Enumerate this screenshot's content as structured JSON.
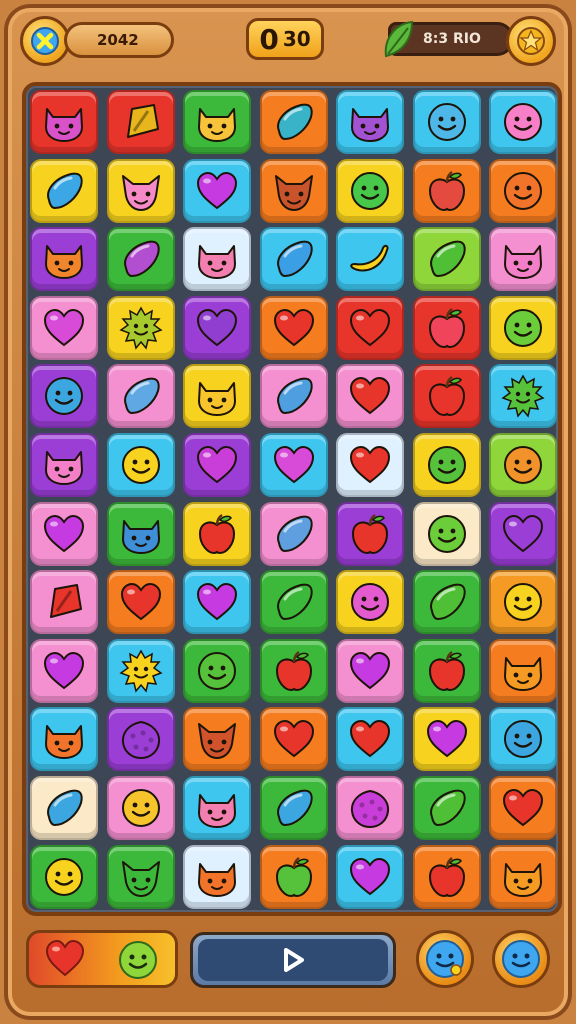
{
  "header": {
    "close_icon": "close-x-icon",
    "level_text": "2042",
    "score_big": "0",
    "score_small": "30",
    "energy_text": "8:3 RIO",
    "leaf_icon": "leaf-icon",
    "coin_icon": "star-coin-icon"
  },
  "colors": {
    "red": "#e8352b",
    "orange": "#f57c1f",
    "green": "#3cb93a",
    "lime": "#8fd63a",
    "yellow": "#f7d21e",
    "cyan": "#3ec6ef",
    "pink": "#f48fd0",
    "purple": "#9b3ed6",
    "magenta": "#d84bd8",
    "pale": "#dff0ff",
    "cream": "#fbe9c8",
    "orange2": "#f59b23"
  },
  "board": {
    "rows": [
      [
        [
          "red",
          "cat-face",
          "#d952c9"
        ],
        [
          "red",
          "candy",
          "#e8b61c"
        ],
        [
          "green",
          "cat-face",
          "#f6c33b"
        ],
        [
          "orange",
          "drop",
          "#39b3c7"
        ],
        [
          "cyan",
          "cat-face",
          "#a352d3"
        ],
        [
          "cyan",
          "smiley",
          "#4fb6e8"
        ],
        [
          "cyan",
          "smiley",
          "#f77fc8"
        ]
      ],
      [
        [
          "yellow",
          "drop",
          "#3ba7e4"
        ],
        [
          "yellow",
          "fox",
          "#f68ac6"
        ],
        [
          "cyan",
          "heart",
          "#c63ae1"
        ],
        [
          "orange",
          "fox",
          "#c9532b"
        ],
        [
          "yellow",
          "smiley",
          "#47c84a"
        ],
        [
          "orange",
          "apple",
          "#e44a3d"
        ],
        [
          "orange",
          "smiley",
          "#f2742a"
        ]
      ],
      [
        [
          "purple",
          "cat-face",
          "#f1852c"
        ],
        [
          "green",
          "drop",
          "#b24fd0"
        ],
        [
          "pale",
          "cat-face",
          "#f27fb0"
        ],
        [
          "cyan",
          "drop",
          "#3a9fe4"
        ],
        [
          "cyan",
          "banana",
          "#f7d21e"
        ],
        [
          "lime",
          "drop",
          "#4fbf35"
        ],
        [
          "pink",
          "cat-face",
          "#f27fc8"
        ]
      ],
      [
        [
          "pink",
          "heart",
          "#d84bd8"
        ],
        [
          "yellow",
          "sun",
          "#a6c92d"
        ],
        [
          "purple",
          "heart",
          "#8f3ed0"
        ],
        [
          "orange",
          "heart",
          "#e8352b"
        ],
        [
          "red",
          "heart",
          "#e8352b"
        ],
        [
          "red",
          "apple",
          "#f0445a"
        ],
        [
          "yellow",
          "smiley",
          "#6ccd3a"
        ]
      ],
      [
        [
          "purple",
          "smiley",
          "#3ca6e0"
        ],
        [
          "pink",
          "drop",
          "#5fa8e4"
        ],
        [
          "yellow",
          "cat-face",
          "#f7c52b"
        ],
        [
          "pink",
          "drop",
          "#4f9fe0"
        ],
        [
          "pink",
          "heart",
          "#e8352b"
        ],
        [
          "red",
          "apple",
          "#e8352b"
        ],
        [
          "cyan",
          "sun",
          "#56c13a"
        ]
      ],
      [
        [
          "purple",
          "cat-face",
          "#f27fc8"
        ],
        [
          "cyan",
          "smiley",
          "#f7d21e"
        ],
        [
          "purple",
          "heart",
          "#c93ed8"
        ],
        [
          "cyan",
          "heart",
          "#d84bd8"
        ],
        [
          "pale",
          "heart",
          "#e8352b"
        ],
        [
          "yellow",
          "smiley",
          "#56c13a"
        ],
        [
          "lime",
          "smiley",
          "#f2922a"
        ]
      ],
      [
        [
          "pink",
          "heart",
          "#c63ae1"
        ],
        [
          "green",
          "cat-face",
          "#3e8fd8"
        ],
        [
          "yellow",
          "apple",
          "#e8352b"
        ],
        [
          "pink",
          "drop",
          "#5f9fe0"
        ],
        [
          "purple",
          "apple",
          "#e8352b"
        ],
        [
          "cream",
          "smiley",
          "#6ccd3a"
        ],
        [
          "purple",
          "heart",
          "#9b3ed6"
        ]
      ],
      [
        [
          "pink",
          "candy",
          "#e8352b"
        ],
        [
          "orange",
          "heart",
          "#e8352b"
        ],
        [
          "cyan",
          "heart",
          "#c63ae1"
        ],
        [
          "green",
          "drop",
          "#3cb93a"
        ],
        [
          "yellow",
          "smiley",
          "#e45bd0"
        ],
        [
          "green",
          "drop",
          "#4fbf35"
        ],
        [
          "orange2",
          "smiley",
          "#f7d21e"
        ]
      ],
      [
        [
          "pink",
          "heart",
          "#c63ae1"
        ],
        [
          "cyan",
          "sun",
          "#f7d21e"
        ],
        [
          "green",
          "smiley",
          "#56c13a"
        ],
        [
          "green",
          "apple",
          "#e8352b"
        ],
        [
          "pink",
          "heart",
          "#c63ae1"
        ],
        [
          "green",
          "apple",
          "#e8352b"
        ],
        [
          "orange",
          "cat-face",
          "#f59b23"
        ]
      ],
      [
        [
          "cyan",
          "cat-face",
          "#f2742a"
        ],
        [
          "purple",
          "berry",
          "#9b3ed6"
        ],
        [
          "orange",
          "fox",
          "#d0532b"
        ],
        [
          "orange",
          "heart",
          "#e8352b"
        ],
        [
          "cyan",
          "heart",
          "#e8352b"
        ],
        [
          "yellow",
          "heart",
          "#c63ae1"
        ],
        [
          "cyan",
          "smiley",
          "#3ca6e0"
        ]
      ],
      [
        [
          "cream",
          "drop",
          "#3ca6e0"
        ],
        [
          "pink",
          "smiley",
          "#f7c52b"
        ],
        [
          "cyan",
          "cat-face",
          "#f27fb0"
        ],
        [
          "green",
          "drop",
          "#3ca6e0"
        ],
        [
          "pink",
          "berry",
          "#c93ed8"
        ],
        [
          "green",
          "drop",
          "#4fbf35"
        ],
        [
          "orange",
          "heart",
          "#e8352b"
        ]
      ],
      [
        [
          "green",
          "smiley",
          "#f7d21e"
        ],
        [
          "green",
          "fox",
          "#3cb93a"
        ],
        [
          "pale",
          "cat-face",
          "#f2742a"
        ],
        [
          "orange",
          "apple",
          "#56c13a"
        ],
        [
          "cyan",
          "heart",
          "#c63ae1"
        ],
        [
          "orange",
          "apple",
          "#e8352b"
        ],
        [
          "orange",
          "cat-face",
          "#f59b23"
        ]
      ]
    ]
  },
  "footer": {
    "tray_left_icon": "heart-icon",
    "tray_right_icon": "smiley-icon",
    "play_icon": "play-icon",
    "hint_icon": "smiley-hint-icon",
    "shuffle_icon": "smiley-face-icon"
  }
}
